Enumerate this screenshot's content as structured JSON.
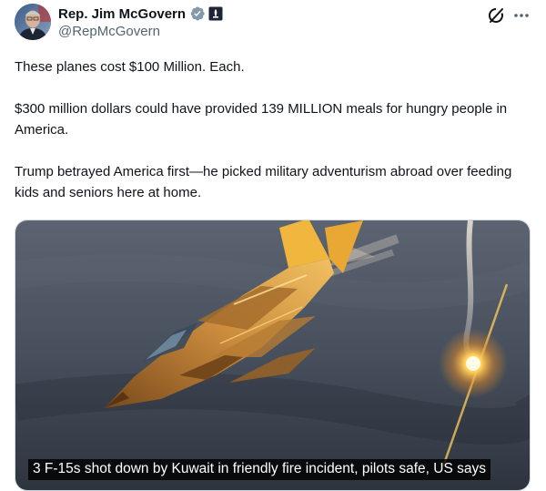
{
  "author": {
    "display_name": "Rep. Jim McGovern",
    "handle": "@RepMcGovern",
    "avatar_icon": "profile-photo",
    "verified_icon": "verified-badge-icon",
    "affiliation_icon": "government-badge-icon"
  },
  "header_actions": {
    "grok_icon": "grok-icon",
    "more_icon": "more-options-icon"
  },
  "tweet": {
    "paragraphs": [
      "These planes cost $100 Million. Each.",
      "$300 million dollars could have provided 139 MILLION meals for hungry people in America.",
      "Trump betrayed America first—he picked military adventurism abroad over feeding kids and seniors here at home."
    ]
  },
  "media": {
    "caption": "3 F-15s shot down by Kuwait in friendly fire incident, pilots safe, US says"
  },
  "colors": {
    "text_primary": "#0f1419",
    "text_secondary": "#536471",
    "verified_gray": "#829aab",
    "border": "#cfd9de"
  }
}
